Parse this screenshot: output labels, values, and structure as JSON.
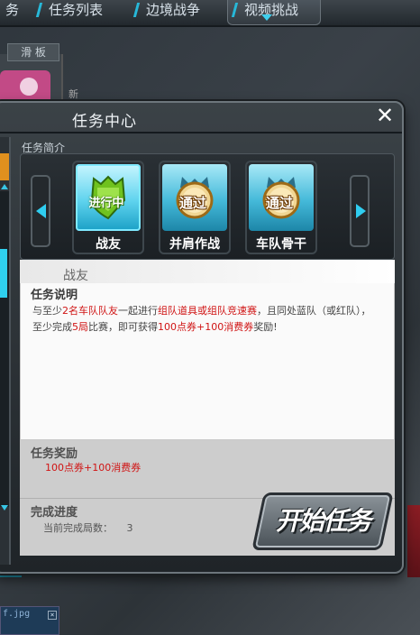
{
  "topnav": {
    "items": [
      {
        "label": "务"
      },
      {
        "label": "任务列表"
      },
      {
        "label": "边境战争"
      },
      {
        "label": "视频挑战"
      }
    ]
  },
  "background": {
    "tab_label": "滑 板",
    "side_label": "新",
    "file_label": "f.jpg"
  },
  "dialog": {
    "title": "任务中心",
    "close_glyph": "✕",
    "intro_label": "任务简介",
    "tasks": [
      {
        "badge": "进行中",
        "label": "战友",
        "state": "running"
      },
      {
        "badge": "通过",
        "label": "并肩作战",
        "state": "passed"
      },
      {
        "badge": "通过",
        "label": "车队骨干",
        "state": "passed"
      }
    ],
    "selected_task_name": "战友",
    "description_title": "任务说明",
    "description_parts": {
      "p1": "与至少",
      "h1": "2名车队队友",
      "p2": "一起进行",
      "h2": "组队道具或组队竞速赛",
      "p3": "，且同处蓝队（或红队），至少完成",
      "h3": "5局",
      "p4": "比赛，即可获得",
      "h4": "100点券+100消费券",
      "p5": "奖励!"
    },
    "reward_title": "任务奖励",
    "reward_value": "100点券+100消费券",
    "progress_title": "完成进度",
    "progress_label": "当前完成局数：",
    "progress_count": "3",
    "start_button": "开始任务"
  },
  "colors": {
    "accent": "#2fcdf0",
    "highlight_red": "#d01414",
    "running_badge": "#6fc21e",
    "passed_badge": "#e8b23a"
  }
}
